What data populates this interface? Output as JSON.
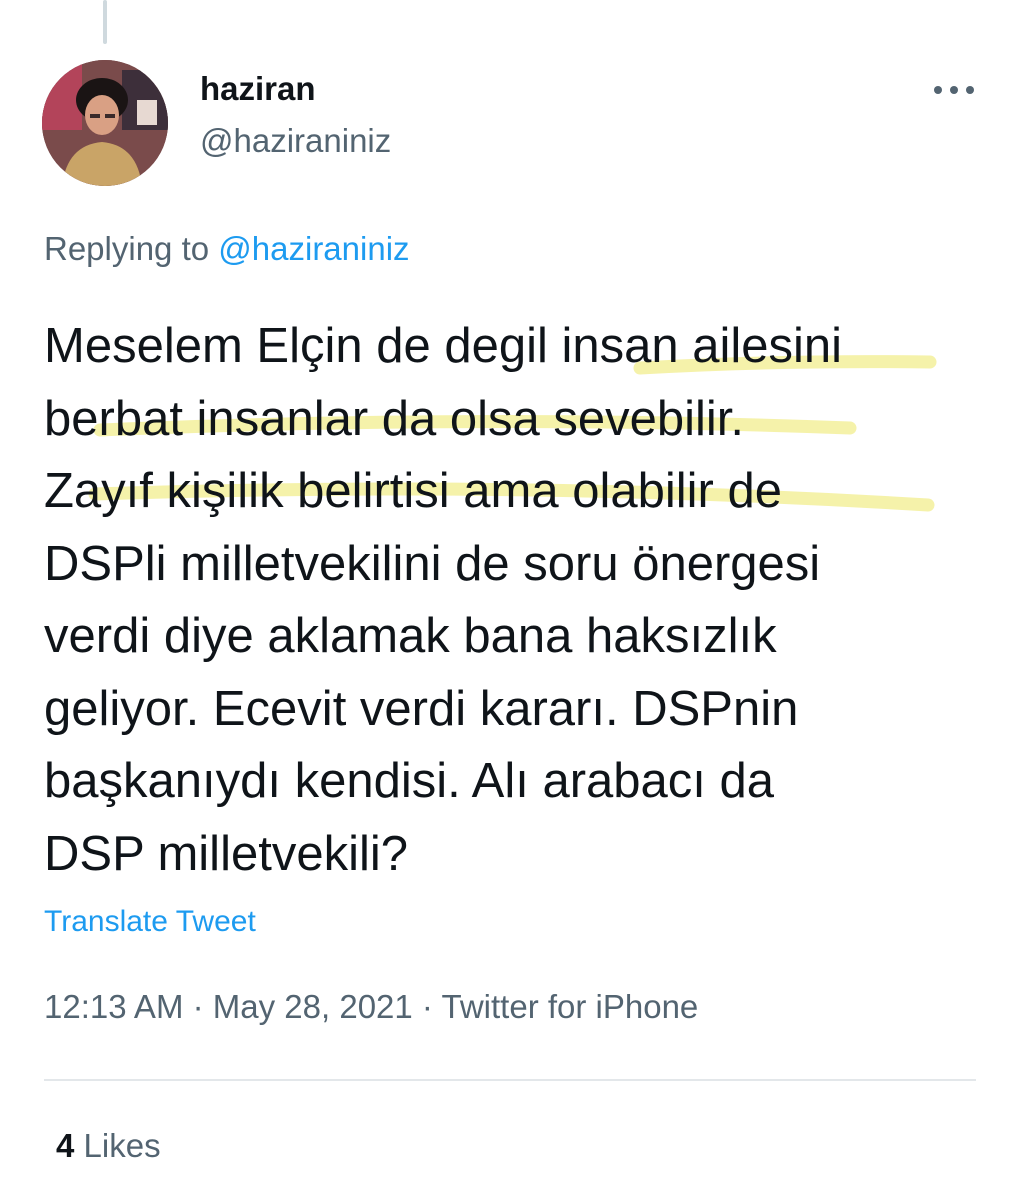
{
  "author": {
    "name": "haziran",
    "handle": "@haziraniniz"
  },
  "reply": {
    "prefix": "Replying to",
    "mention": "@haziraniniz"
  },
  "tweet": {
    "lines": [
      "Meselem Elçin de degil insan ailesini",
      "berbat insanlar da olsa sevebilir.",
      "Zayıf kişilik belirtisi ama olabilir de",
      "DSPli milletvekilini de soru önergesi",
      "verdi diye aklamak bana haksızlık",
      "geliyor. Ecevit verdi kararı. DSPnin",
      "başkanıydı kendisi. Alı arabacı da",
      "DSP milletvekili?"
    ]
  },
  "translate_label": "Translate Tweet",
  "meta": {
    "time": "12:13 AM",
    "separator": "·",
    "date": "May 28, 2021",
    "source": "Twitter for iPhone"
  },
  "stats": {
    "likes_count": "4",
    "likes_label": "Likes"
  },
  "colors": {
    "link": "#1d9bf0",
    "muted": "#536471",
    "highlight": "#f2ee8e"
  }
}
